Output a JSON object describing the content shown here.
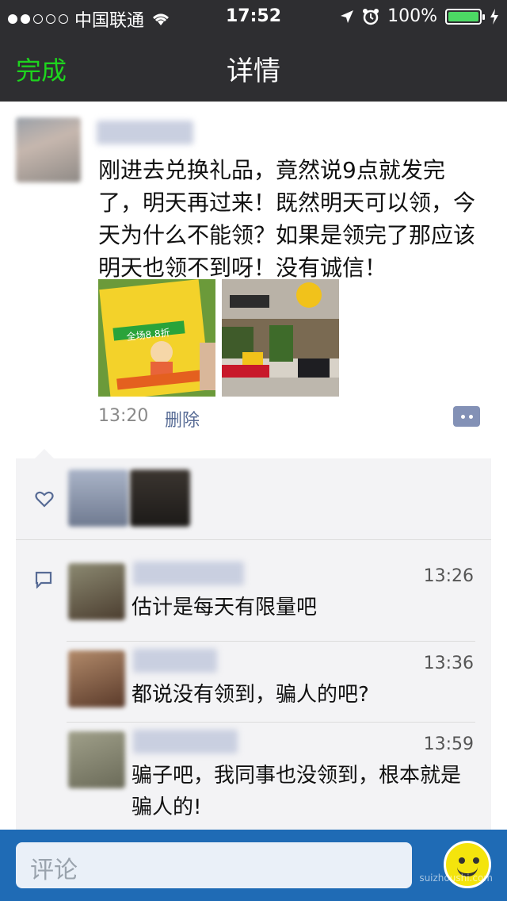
{
  "status_bar": {
    "carrier": "中国联通",
    "time": "17:52",
    "battery": "100%",
    "signal_icon": "signal-dots-icon",
    "wifi_icon": "wifi-icon",
    "location_icon": "location-arrow-icon",
    "alarm_icon": "alarm-clock-icon",
    "charging_icon": "charging-bolt-icon"
  },
  "nav": {
    "done_label": "完成",
    "title": "详情",
    "done_color": "#1ed41e"
  },
  "post": {
    "text": "刚进去兑换礼品，竟然说9点就发完了，明天再过来！既然明天可以领，今天为什么不能领？如果是领完了那应该明天也领不到呀！没有诚信！",
    "images": [
      {
        "name": "flyer-photo",
        "text": "全场8.8折"
      },
      {
        "name": "storefront-photo"
      }
    ],
    "time": "13:20",
    "delete_label": "删除"
  },
  "comments": [
    {
      "time": "13:26",
      "text": "估计是每天有限量吧"
    },
    {
      "time": "13:36",
      "text": "都说没有领到，骗人的吧?"
    },
    {
      "time": "13:59",
      "text": "骗子吧，我同事也没领到，根本就是骗人的!"
    }
  ],
  "bottom": {
    "comment_placeholder": "评论",
    "emoji_icon": "smiley-icon",
    "watermark": "suizhoushi.com"
  },
  "colors": {
    "nav_bg": "#2e2e31",
    "link_blue": "#576b95",
    "bottom_bar": "#1f6bb5"
  }
}
